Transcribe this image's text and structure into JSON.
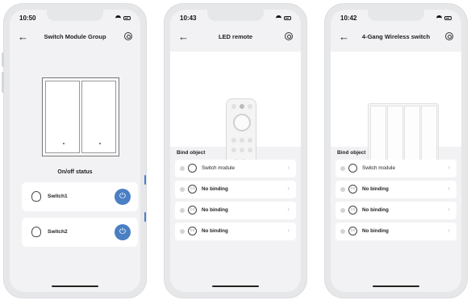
{
  "screens": [
    {
      "time": "10:50",
      "title": "Switch Module Group",
      "status_label": "On/off status",
      "switches": [
        {
          "label": "Switch1",
          "icon": "bulb-icon"
        },
        {
          "label": "Switch2",
          "icon": "bulb-icon"
        }
      ]
    },
    {
      "time": "10:43",
      "title": "LED remote",
      "section": "Bind object",
      "rows": [
        {
          "label": "Switch module",
          "icon": "bulb-icon"
        },
        {
          "label": "No binding",
          "icon": "unlinked-icon"
        },
        {
          "label": "No binding",
          "icon": "unlinked-icon"
        },
        {
          "label": "No binding",
          "icon": "unlinked-icon"
        }
      ]
    },
    {
      "time": "10:42",
      "title": "4-Gang Wireless switch",
      "section": "Bind object",
      "rows": [
        {
          "label": "Switch module",
          "icon": "bulb-icon"
        },
        {
          "label": "No binding",
          "icon": "unlinked-icon"
        },
        {
          "label": "No binding",
          "icon": "unlinked-icon"
        },
        {
          "label": "No binding",
          "icon": "unlinked-icon"
        }
      ]
    }
  ],
  "colors": {
    "accent": "#4a7fc4",
    "background": "#f2f2f4"
  }
}
